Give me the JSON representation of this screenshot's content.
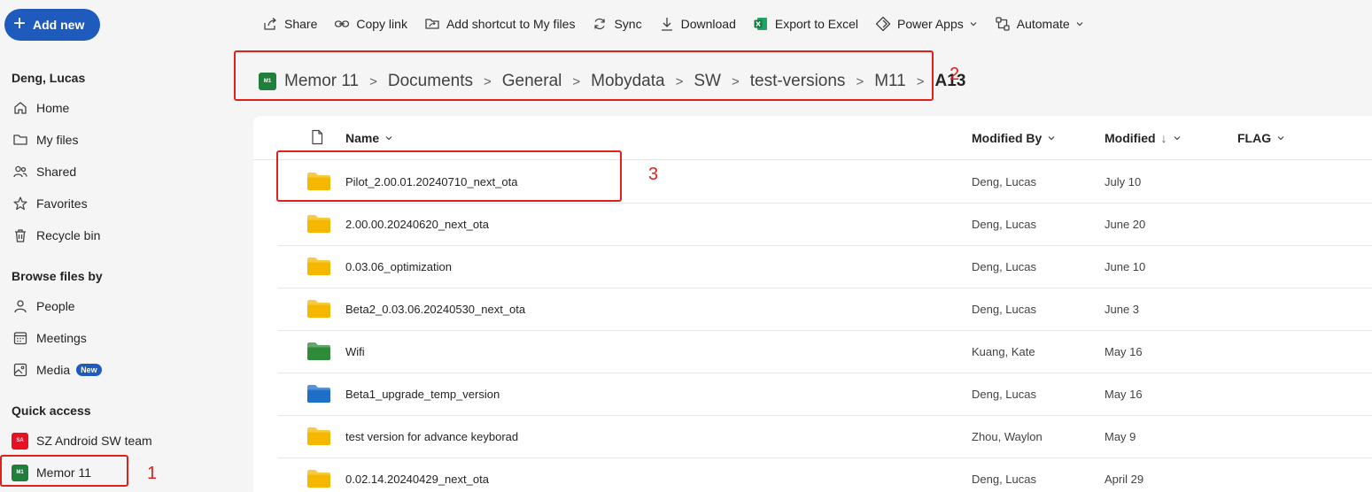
{
  "sidebar": {
    "add_new": "Add new",
    "user_name": "Deng, Lucas",
    "nav": [
      {
        "label": "Home",
        "icon": "home-icon"
      },
      {
        "label": "My files",
        "icon": "folder-icon"
      },
      {
        "label": "Shared",
        "icon": "people-icon"
      },
      {
        "label": "Favorites",
        "icon": "star-icon"
      },
      {
        "label": "Recycle bin",
        "icon": "trash-icon"
      }
    ],
    "browse_heading": "Browse files by",
    "browse": [
      {
        "label": "People",
        "icon": "person-icon"
      },
      {
        "label": "Meetings",
        "icon": "calendar-icon"
      },
      {
        "label": "Media",
        "icon": "image-icon",
        "badge": "New"
      }
    ],
    "quick_heading": "Quick access",
    "quick": [
      {
        "label": "SZ Android SW team",
        "abbr": "SA",
        "color": "#e81123"
      },
      {
        "label": "Memor 11",
        "abbr": "M1",
        "color": "#1f7f3b"
      }
    ]
  },
  "toolbar": {
    "items": [
      {
        "label": "Share",
        "icon": "share-icon"
      },
      {
        "label": "Copy link",
        "icon": "link-icon"
      },
      {
        "label": "Add shortcut to My files",
        "icon": "shortcut-icon"
      },
      {
        "label": "Sync",
        "icon": "sync-icon"
      },
      {
        "label": "Download",
        "icon": "download-icon"
      },
      {
        "label": "Export to Excel",
        "icon": "excel-icon"
      },
      {
        "label": "Power Apps",
        "icon": "powerapps-icon",
        "dropdown": true
      },
      {
        "label": "Automate",
        "icon": "automate-icon",
        "dropdown": true
      }
    ]
  },
  "breadcrumb": {
    "site_abbr": "M1",
    "items": [
      "Memor 11",
      "Documents",
      "General",
      "Mobydata",
      "SW",
      "test-versions",
      "M11"
    ],
    "current": "A13"
  },
  "table": {
    "headers": {
      "name": "Name",
      "modified_by": "Modified By",
      "modified": "Modified",
      "modified_sort": "↓",
      "flag": "FLAG"
    },
    "rows": [
      {
        "name": "Pilot_2.00.01.20240710_next_ota",
        "modified_by": "Deng, Lucas",
        "modified": "July 10",
        "folder_color": "#f5b800"
      },
      {
        "name": "2.00.00.20240620_next_ota",
        "modified_by": "Deng, Lucas",
        "modified": "June 20",
        "folder_color": "#f5b800"
      },
      {
        "name": "0.03.06_optimization",
        "modified_by": "Deng, Lucas",
        "modified": "June 10",
        "folder_color": "#f5b800"
      },
      {
        "name": "Beta2_0.03.06.20240530_next_ota",
        "modified_by": "Deng, Lucas",
        "modified": "June 3",
        "folder_color": "#f5b800"
      },
      {
        "name": "Wifi",
        "modified_by": "Kuang, Kate",
        "modified": "May 16",
        "folder_color": "#2e8b3a"
      },
      {
        "name": "Beta1_upgrade_temp_version",
        "modified_by": "Deng, Lucas",
        "modified": "May 16",
        "folder_color": "#1f6fc8"
      },
      {
        "name": "test version for advance keyborad",
        "modified_by": "Zhou, Waylon",
        "modified": "May 9",
        "folder_color": "#f5b800"
      },
      {
        "name": "0.02.14.20240429_next_ota",
        "modified_by": "Deng, Lucas",
        "modified": "April 29",
        "folder_color": "#f5b800"
      }
    ]
  },
  "annotations": [
    "1",
    "2",
    "3"
  ],
  "accent_color": "#1e5bbd",
  "annotation_color": "#e0201b"
}
